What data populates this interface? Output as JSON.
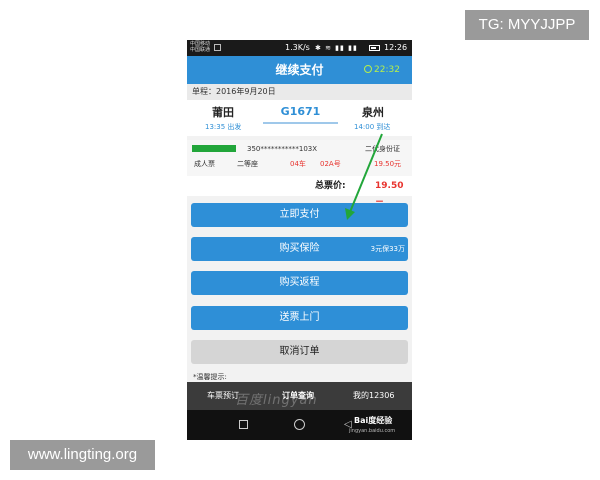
{
  "watermarks": {
    "tg": "TG: MYYJJPP",
    "site": "www.lingting.org",
    "baidu_overlay": "百度lingyan",
    "baidu_logo": "Bai度经验",
    "baidu_url": "jingyan.baidu.com"
  },
  "statusbar": {
    "carrier_line1": "中国移动",
    "carrier_line2": "中国联通",
    "speed": "1.3K/s",
    "icons_text": "✱ ≋ ▮▮ ▮▮",
    "time": "12:26"
  },
  "header": {
    "title": "继续支付",
    "countdown": "22:32"
  },
  "trip": {
    "date_line": "单程：2016年9月20日",
    "from_station": "莆田",
    "from_time": "13:35 出发",
    "train_no": "G1671",
    "to_station": "泉州",
    "to_time": "14:00 到达"
  },
  "passenger": {
    "id_masked": "350***********103X",
    "id_type": "二代身份证",
    "ticket_type": "成人票",
    "seat_class": "二等座",
    "car": "04车",
    "seat": "02A号",
    "price": "19.50元"
  },
  "total": {
    "label": "总票价:",
    "value": "19.50元"
  },
  "buttons": {
    "pay_now": "立即支付",
    "buy_insurance": "购买保险",
    "insurance_note": "3元保33万",
    "buy_return": "购买返程",
    "deliver": "送票上门",
    "cancel_order": "取消订单"
  },
  "tip": "*温馨提示:",
  "bottom_nav": {
    "booking": "车票预订",
    "orders": "订单查询",
    "mine": "我的12306"
  },
  "colors": {
    "primary": "#2f8fd6",
    "timer": "#b6ef4c",
    "price_red": "#e8342f",
    "arrow_green": "#22a63a"
  }
}
